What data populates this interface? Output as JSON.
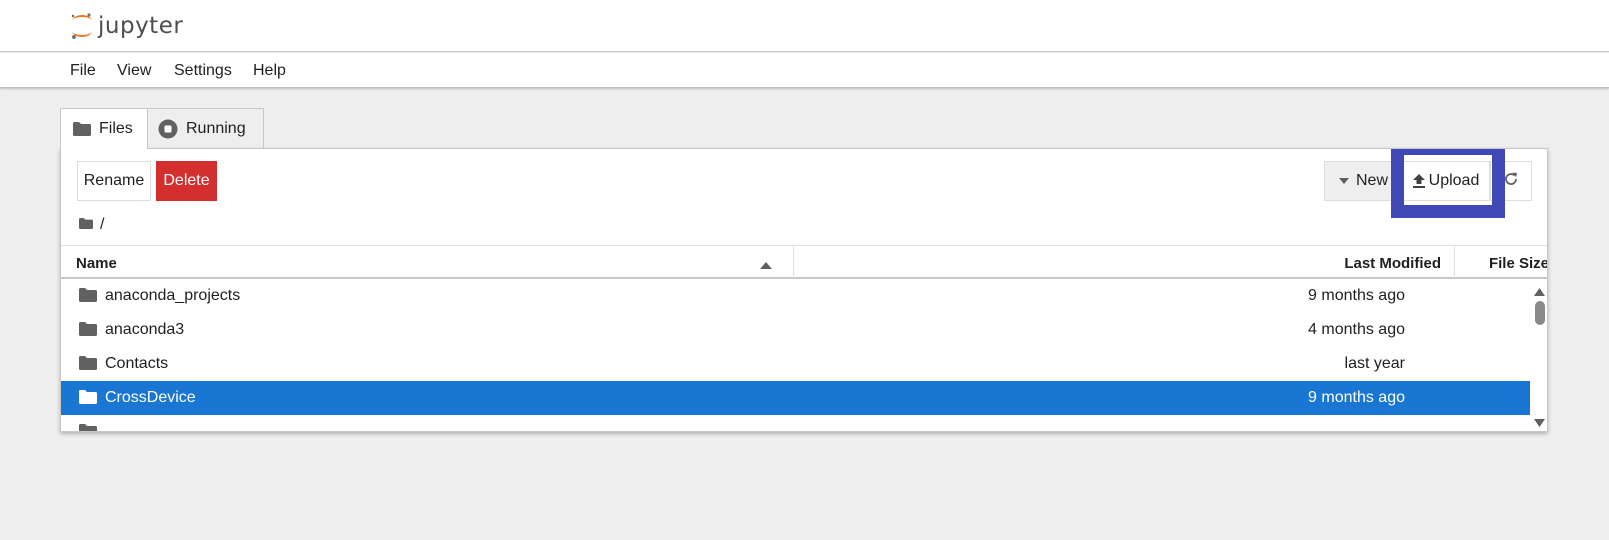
{
  "header": {
    "logo_text": "jupyter"
  },
  "menu": {
    "items": [
      "File",
      "View",
      "Settings",
      "Help"
    ]
  },
  "tabs": {
    "files": "Files",
    "running": "Running"
  },
  "toolbar": {
    "rename": "Rename",
    "delete": "Delete",
    "new": "New",
    "upload": "Upload"
  },
  "breadcrumb": {
    "path": "/"
  },
  "table": {
    "headers": {
      "name": "Name",
      "modified": "Last Modified",
      "size": "File Size"
    },
    "rows": [
      {
        "name": "anaconda_projects",
        "modified": "9 months ago"
      },
      {
        "name": "anaconda3",
        "modified": "4 months ago"
      },
      {
        "name": "Contacts",
        "modified": "last year"
      },
      {
        "name": "CrossDevice",
        "modified": "9 months ago"
      },
      {
        "name": "",
        "modified": ""
      }
    ]
  },
  "colors": {
    "delete_bg": "#d32f2f",
    "selected_row": "#1976d2",
    "highlight_box": "#3f48b4",
    "logo_orange": "#f37726"
  },
  "icons": {
    "folder": "folder-icon",
    "running": "stop-circle-icon",
    "upload": "upload-icon",
    "refresh": "refresh-icon",
    "sort": "sort-ascending-icon",
    "caret": "caret-down-icon"
  }
}
